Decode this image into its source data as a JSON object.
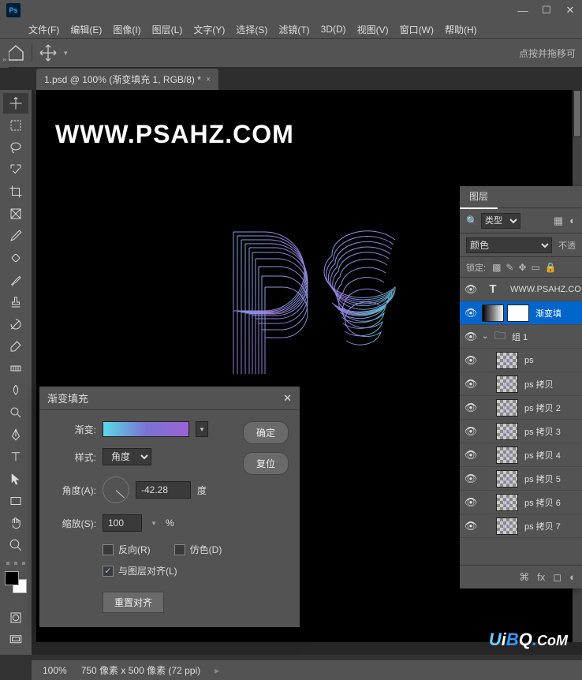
{
  "titlebar": {
    "logo": "Ps",
    "min": "—",
    "max": "☐",
    "close": "✕"
  },
  "menu": {
    "file": "文件(F)",
    "edit": "编辑(E)",
    "image": "图像(I)",
    "layer": "图层(L)",
    "type": "文字(Y)",
    "select": "选择(S)",
    "filter": "滤镜(T)",
    "threeD": "3D(D)",
    "view": "视图(V)",
    "window": "窗口(W)",
    "help": "帮助(H)"
  },
  "options": {
    "hint": "点按并拖移可"
  },
  "tab": {
    "title": "1.psd @ 100% (渐变填充 1, RGB/8) *",
    "close": "×"
  },
  "canvas": {
    "heading": "WWW.PSAHZ.COM",
    "watermark_u": "U",
    "watermark_i": "i",
    "watermark_b": "B",
    "watermark_q": "Q",
    "watermark_dot": ".",
    "watermark_c": "C",
    "watermark_o": "o",
    "watermark_m": "M"
  },
  "status": {
    "zoom": "100%",
    "docinfo": "750 像素 x 500 像素 (72 ppi)"
  },
  "layers": {
    "tab": "图层",
    "filter_label": "类型",
    "blend_mode": "颜色",
    "opacity_label": "不透",
    "lock_label": "锁定:",
    "items": {
      "text": "WWW.PSAHZ.CO",
      "gradfill": "渐变填",
      "group": "组 1",
      "ps": "ps",
      "copy": "ps 拷贝",
      "copy2": "ps 拷贝 2",
      "copy3": "ps 拷贝 3",
      "copy4": "ps 拷贝 4",
      "copy5": "ps 拷贝 5",
      "copy6": "ps 拷贝 6",
      "copy7": "ps 拷贝 7"
    },
    "footer_fx": "fx"
  },
  "dialog": {
    "title": "渐变填充",
    "gradient_label": "渐变:",
    "style_label": "样式:",
    "style_value": "角度",
    "angle_label": "角度(A):",
    "angle_value": "-42.28",
    "angle_unit": "度",
    "scale_label": "缩放(S):",
    "scale_value": "100",
    "scale_unit": "%",
    "reverse": "反向(R)",
    "dither": "仿色(D)",
    "align": "与图层对齐(L)",
    "reset": "重置对齐",
    "ok": "确定",
    "cancel": "复位"
  }
}
